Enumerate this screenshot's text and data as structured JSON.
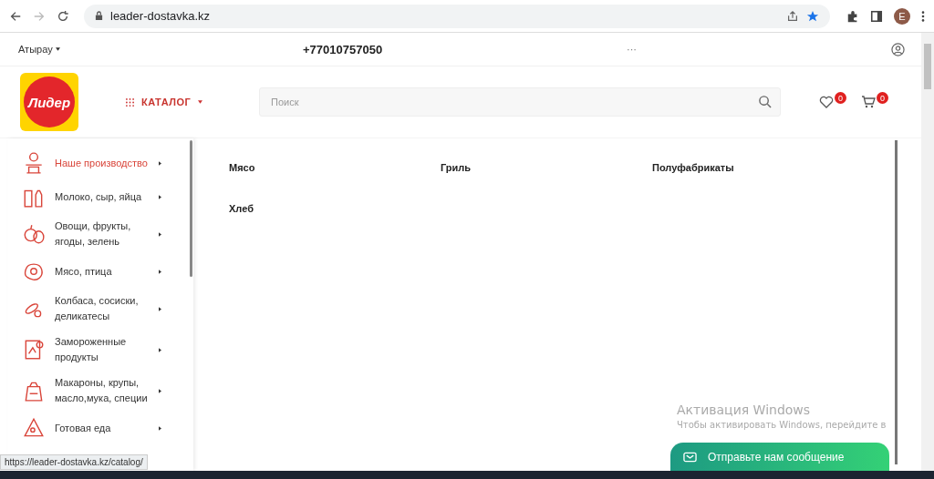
{
  "browser": {
    "url": "leader-dostavka.kz",
    "avatar": "E"
  },
  "topbar": {
    "city": "Атырау",
    "phone": "+77010757050",
    "more": "···"
  },
  "header": {
    "logo": "Лидер",
    "catalog": "КАТАЛОГ",
    "search": {
      "placeholder": "Поиск"
    },
    "wishlist_count": "0",
    "cart_count": "0"
  },
  "sidebar": {
    "items": [
      {
        "label": "Наше производство",
        "selected": true
      },
      {
        "label": "Молоко, сыр, яйца",
        "selected": false
      },
      {
        "label": "Овощи, фрукты, ягоды, зелень",
        "selected": false
      },
      {
        "label": "Мясо, птица",
        "selected": false
      },
      {
        "label": "Колбаса, сосиски, деликатесы",
        "selected": false
      },
      {
        "label": "Замороженные продукты",
        "selected": false
      },
      {
        "label": "Макароны, крупы, масло,мука, специи",
        "selected": false
      },
      {
        "label": "Готовая еда",
        "selected": false
      }
    ]
  },
  "subcategories": [
    "Мясо",
    "Гриль",
    "Полуфабрикаты",
    "Хлеб"
  ],
  "chat": {
    "label": "Отправьте нам сообщение"
  },
  "os_notice": {
    "title": "Активация Windows",
    "text": "Чтобы активировать Windows, перейдите в"
  },
  "status_url": "https://leader-dostavka.kz/catalog/"
}
